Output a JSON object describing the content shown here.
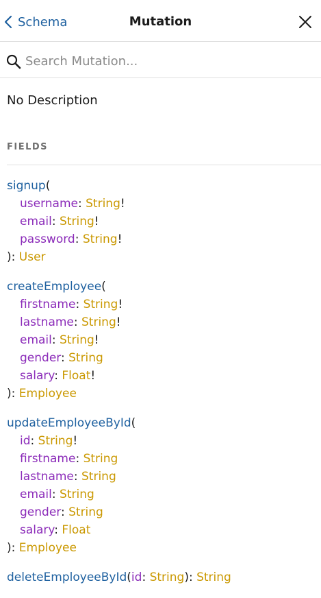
{
  "header": {
    "back_label": "Schema",
    "title": "Mutation"
  },
  "search": {
    "placeholder": "Search Mutation..."
  },
  "description": "No Description",
  "section_title": "FIELDS",
  "fields": [
    {
      "name": "signup",
      "args": [
        {
          "name": "username",
          "type": "String",
          "required": "!"
        },
        {
          "name": "email",
          "type": "String",
          "required": "!"
        },
        {
          "name": "password",
          "type": "String",
          "required": "!"
        }
      ],
      "return_type": "User"
    },
    {
      "name": "createEmployee",
      "args": [
        {
          "name": "firstname",
          "type": "String",
          "required": "!"
        },
        {
          "name": "lastname",
          "type": "String",
          "required": "!"
        },
        {
          "name": "email",
          "type": "String",
          "required": "!"
        },
        {
          "name": "gender",
          "type": "String",
          "required": ""
        },
        {
          "name": "salary",
          "type": "Float",
          "required": "!"
        }
      ],
      "return_type": "Employee"
    },
    {
      "name": "updateEmployeeById",
      "args": [
        {
          "name": "id",
          "type": "String",
          "required": "!"
        },
        {
          "name": "firstname",
          "type": "String",
          "required": ""
        },
        {
          "name": "lastname",
          "type": "String",
          "required": ""
        },
        {
          "name": "email",
          "type": "String",
          "required": ""
        },
        {
          "name": "gender",
          "type": "String",
          "required": ""
        },
        {
          "name": "salary",
          "type": "Float",
          "required": ""
        }
      ],
      "return_type": "Employee"
    },
    {
      "name": "deleteEmployeeById",
      "inline_arg": {
        "name": "id",
        "type": "String",
        "required": ""
      },
      "return_type": "String"
    }
  ],
  "colors": {
    "field_name": "#1f61a0",
    "argument": "#8b2bb9",
    "type": "#ca9800",
    "muted": "#707070"
  },
  "icons": {
    "back": "chevron-left-icon",
    "close": "close-icon",
    "search": "search-icon"
  }
}
